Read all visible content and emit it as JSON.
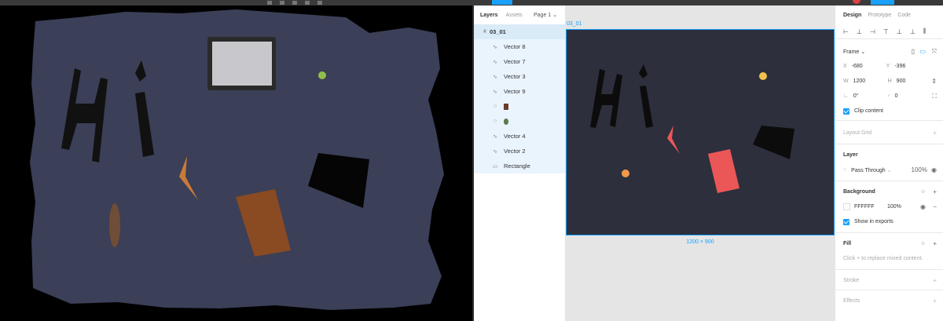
{
  "layers_panel": {
    "tabs": [
      "Layers",
      "Assets"
    ],
    "page": "Page 1",
    "frame": {
      "name": "03_01",
      "icon": "frame-hash-icon"
    },
    "items": [
      {
        "name": "Vector 8",
        "icon": "vector-icon"
      },
      {
        "name": "Vector 7",
        "icon": "vector-icon"
      },
      {
        "name": "Vector 3",
        "icon": "vector-icon"
      },
      {
        "name": "Vector 9",
        "icon": "vector-icon"
      },
      {
        "name": "",
        "icon": "ellipse-icon"
      },
      {
        "name": "",
        "icon": "ellipse-icon"
      },
      {
        "name": "Vector 4",
        "icon": "vector-icon"
      },
      {
        "name": "Vector 2",
        "icon": "vector-icon"
      },
      {
        "name": "Rectangle",
        "icon": "rectangle-icon"
      }
    ]
  },
  "canvas": {
    "frame_label": "03_01",
    "dimensions_label": "1200 × 900"
  },
  "design_panel": {
    "tabs": [
      "Design",
      "Prototype",
      "Code"
    ],
    "frame_label": "Frame",
    "x_label": "X",
    "x_value": "-680",
    "y_label": "Y",
    "y_value": "-396",
    "w_label": "W",
    "w_value": "1200",
    "h_label": "H",
    "h_value": "900",
    "rotation": "0°",
    "radius": "0",
    "clip_content": "Clip content",
    "layout_grid": "Layout Grid",
    "layer_title": "Layer",
    "blend_mode": "Pass Through",
    "layer_opacity": "100%",
    "background_title": "Background",
    "bg_hex": "FFFFFF",
    "bg_opacity": "100%",
    "show_in_exports": "Show in exports",
    "fill_title": "Fill",
    "fill_hint": "Click + to replace mixed content.",
    "stroke_title": "Stroke",
    "effects_title": "Effects"
  },
  "colors": {
    "accent": "#18a0fb",
    "frame_bg": "#2d2f3c",
    "coral": "#eb5757",
    "yellow": "#f2c14e",
    "orange": "#f2994a"
  }
}
